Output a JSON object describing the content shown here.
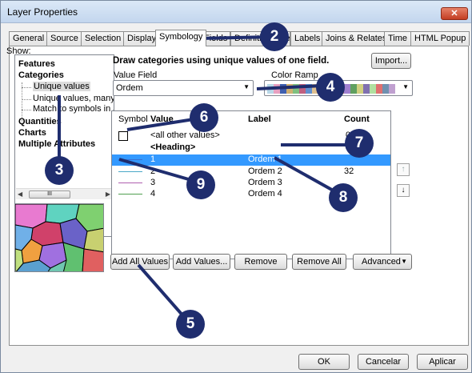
{
  "window": {
    "title": "Layer Properties",
    "close_glyph": "✕"
  },
  "tabs": [
    "General",
    "Source",
    "Selection",
    "Display",
    "Symbology",
    "Fields",
    "Definition Query",
    "Labels",
    "Joins & Relates",
    "Time",
    "HTML Popup"
  ],
  "show": {
    "label": "Show:",
    "items": [
      {
        "label": "Features",
        "level": 0
      },
      {
        "label": "Categories",
        "level": 0
      },
      {
        "label": "Unique values",
        "level": 1,
        "selected": true
      },
      {
        "label": "Unique values, many",
        "level": 1
      },
      {
        "label": "Match to symbols in a",
        "level": 1
      },
      {
        "label": "Quantities",
        "level": 0
      },
      {
        "label": "Charts",
        "level": 0
      },
      {
        "label": "Multiple Attributes",
        "level": 0
      }
    ],
    "scroll_thumb": "III"
  },
  "header": {
    "heading": "Draw categories using unique values of one field.",
    "import_label": "Import..."
  },
  "value_field": {
    "label": "Value Field",
    "value": "Ordem"
  },
  "color_ramp": {
    "label": "Color Ramp",
    "colors": [
      "#b8d8e8",
      "#e8a0c0",
      "#4060b0",
      "#d0b070",
      "#80c080",
      "#c06080",
      "#6090d0",
      "#e0c090",
      "#90a0e0",
      "#c080b0",
      "#70b0a0",
      "#e09060",
      "#a080d0",
      "#60a060",
      "#d0d080",
      "#8070b0",
      "#b0e0a0",
      "#e07070",
      "#7090b0",
      "#c0a0d0"
    ]
  },
  "grid": {
    "headers": {
      "symbol": "Symbol",
      "value": "Value",
      "label": "Label",
      "count": "Count"
    },
    "rows": [
      {
        "value": "<all other values>",
        "label": "",
        "count": "0",
        "kind": "box"
      },
      {
        "value": "<Heading>",
        "label": "",
        "count": "",
        "kind": "heading"
      },
      {
        "value": "1",
        "label": "Ordem 1",
        "count": "",
        "kind": "line",
        "color": "#3a6fd0",
        "selected": true
      },
      {
        "value": "2",
        "label": "Ordem 2",
        "count": "32",
        "kind": "line",
        "color": "#4aa8c8"
      },
      {
        "value": "3",
        "label": "Ordem 3",
        "count": "",
        "kind": "line",
        "color": "#b060b0"
      },
      {
        "value": "4",
        "label": "Ordem 4",
        "count": "",
        "kind": "line",
        "color": "#50a050"
      }
    ]
  },
  "arrows": {
    "up": "↑",
    "down": "↓"
  },
  "buttons": {
    "add_all": "Add All Values",
    "add_values": "Add Values...",
    "remove": "Remove",
    "remove_all": "Remove All",
    "advanced": "Advanced"
  },
  "footer": {
    "ok": "OK",
    "cancel": "Cancelar",
    "apply": "Aplicar"
  },
  "callouts": [
    "2",
    "3",
    "4",
    "5",
    "6",
    "7",
    "8",
    "9"
  ]
}
